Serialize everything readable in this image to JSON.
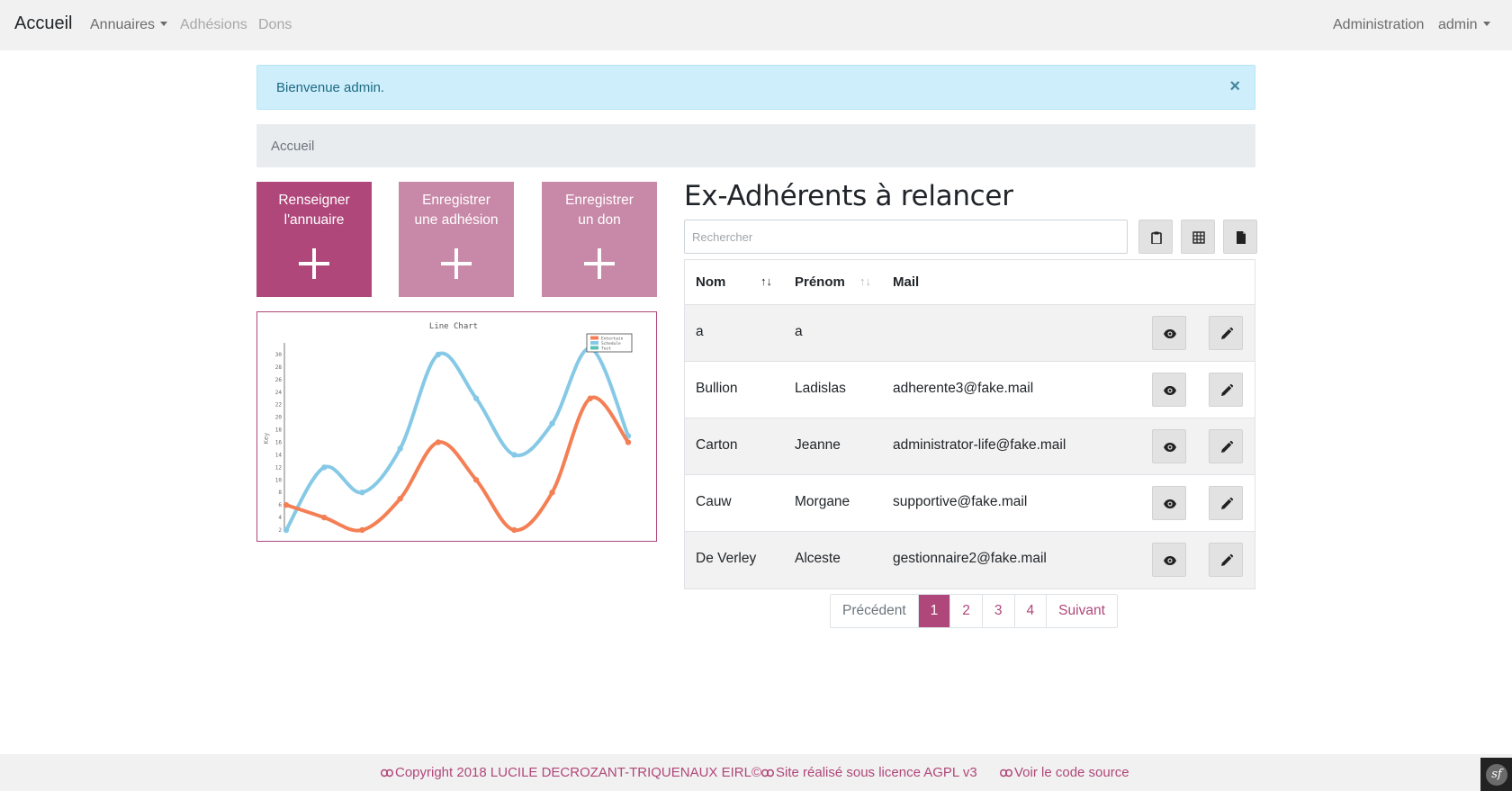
{
  "navbar": {
    "brand": "Accueil",
    "items": [
      {
        "label": "Annuaires",
        "dropdown": true
      },
      {
        "label": "Adhésions"
      },
      {
        "label": "Dons"
      }
    ],
    "right": {
      "admin_link": "Administration",
      "user_menu": "admin"
    }
  },
  "alert": {
    "message": "Bienvenue admin.",
    "close": "×"
  },
  "breadcrumb": {
    "current": "Accueil"
  },
  "tiles": [
    {
      "label_line1": "Renseigner",
      "label_line2": "l'annuaire",
      "icon": "plus-icon"
    },
    {
      "label_line1": "Enregistrer",
      "label_line2": "une adhésion",
      "icon": "plus-icon"
    },
    {
      "label_line1": "Enregistrer",
      "label_line2": "un don",
      "icon": "plus-icon"
    }
  ],
  "chart_data": {
    "type": "line",
    "title": "Line Chart",
    "ylabel": "Key",
    "xlabel": "",
    "y_ticks": [
      "2",
      "4",
      "6",
      "8",
      "10",
      "12",
      "14",
      "16",
      "18",
      "20",
      "22",
      "24",
      "26",
      "28",
      "30"
    ],
    "ylim": [
      2,
      31
    ],
    "legend_position": "top-right",
    "x": [
      0,
      1,
      2,
      3,
      4,
      5,
      6,
      7,
      8,
      9
    ],
    "series": [
      {
        "name": "Entertain",
        "color": "#f47f55",
        "values": [
          6,
          4,
          2,
          7,
          16,
          10,
          2,
          8,
          23,
          16
        ]
      },
      {
        "name": "Schedule",
        "color": "#86c9e6",
        "values": [
          2,
          12,
          8,
          15,
          30,
          23,
          14,
          19,
          31,
          17
        ]
      },
      {
        "name": "Test",
        "color": "#5bc0b5",
        "values": []
      }
    ]
  },
  "section": {
    "title": "Ex-Adhérents à relancer"
  },
  "search": {
    "placeholder": "Rechercher",
    "value": ""
  },
  "toolbar": [
    {
      "icon": "clipboard-icon"
    },
    {
      "icon": "table-grid-icon"
    },
    {
      "icon": "file-icon"
    }
  ],
  "table": {
    "columns": [
      "Nom",
      "Prénom",
      "Mail"
    ],
    "sort_icons": [
      "↑↓",
      "↑↓"
    ],
    "rows": [
      {
        "nom": "a",
        "prenom": "a",
        "mail": ""
      },
      {
        "nom": "Bullion",
        "prenom": "Ladislas",
        "mail": "adherente3@fake.mail"
      },
      {
        "nom": "Carton",
        "prenom": "Jeanne",
        "mail": "administrator-life@fake.mail"
      },
      {
        "nom": "Cauw",
        "prenom": "Morgane",
        "mail": "supportive@fake.mail"
      },
      {
        "nom": "De Verley",
        "prenom": "Alceste",
        "mail": "gestionnaire2@fake.mail"
      }
    ],
    "row_actions": [
      "eye-icon",
      "pencil-icon"
    ]
  },
  "pagination": {
    "prev": "Précédent",
    "pages": [
      "1",
      "2",
      "3",
      "4"
    ],
    "active": "1",
    "next": "Suivant"
  },
  "footer": {
    "links": [
      {
        "label": "Copyright 2018 LUCILE DECROZANT-TRIQUENAUX EIRL©",
        "icon": "link-icon"
      },
      {
        "label": "Site réalisé sous licence AGPL v3",
        "icon": "link-icon"
      },
      {
        "label": "Voir le code source",
        "icon": "link-icon"
      }
    ],
    "badge": "sf"
  },
  "colors": {
    "accent": "#b0477a",
    "accent_light": "#c888a8",
    "alert_bg": "#cdeefa"
  }
}
